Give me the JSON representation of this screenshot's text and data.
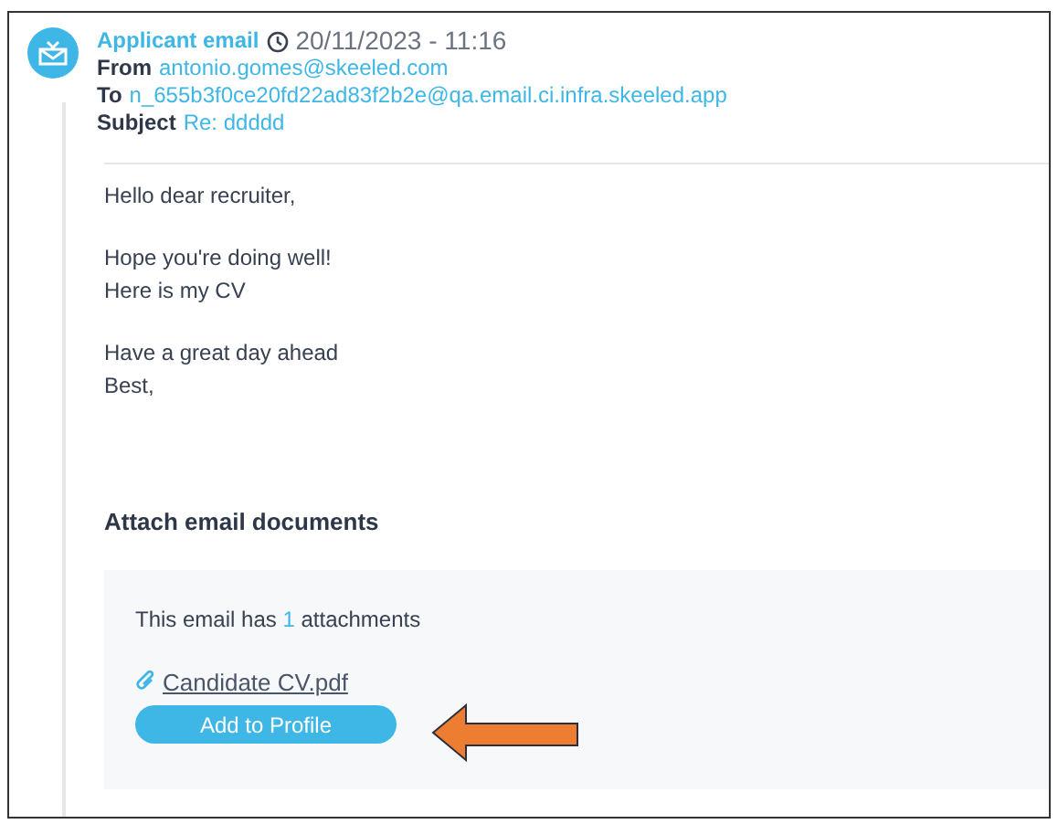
{
  "email": {
    "type": "Applicant email",
    "datetime": "20/11/2023 - 11:16",
    "fields": [
      {
        "label": "From",
        "value": "antonio.gomes@skeeled.com"
      },
      {
        "label": "To",
        "value": "n_655b3f0ce20fd22ad83f2b2e@qa.email.ci.infra.skeeled.app"
      },
      {
        "label": "Subject",
        "value": "Re: ddddd"
      }
    ],
    "body": [
      [
        "Hello dear recruiter,"
      ],
      [
        "Hope you're doing well!",
        "Here is my CV"
      ],
      [
        "Have a great day ahead",
        "Best,"
      ]
    ]
  },
  "attachments": {
    "heading": "Attach email documents",
    "summary_before": "This email has",
    "count": "1",
    "summary_after": "attachments",
    "files": [
      {
        "name": "Candidate CV.pdf"
      }
    ],
    "button": "Add to Profile"
  }
}
